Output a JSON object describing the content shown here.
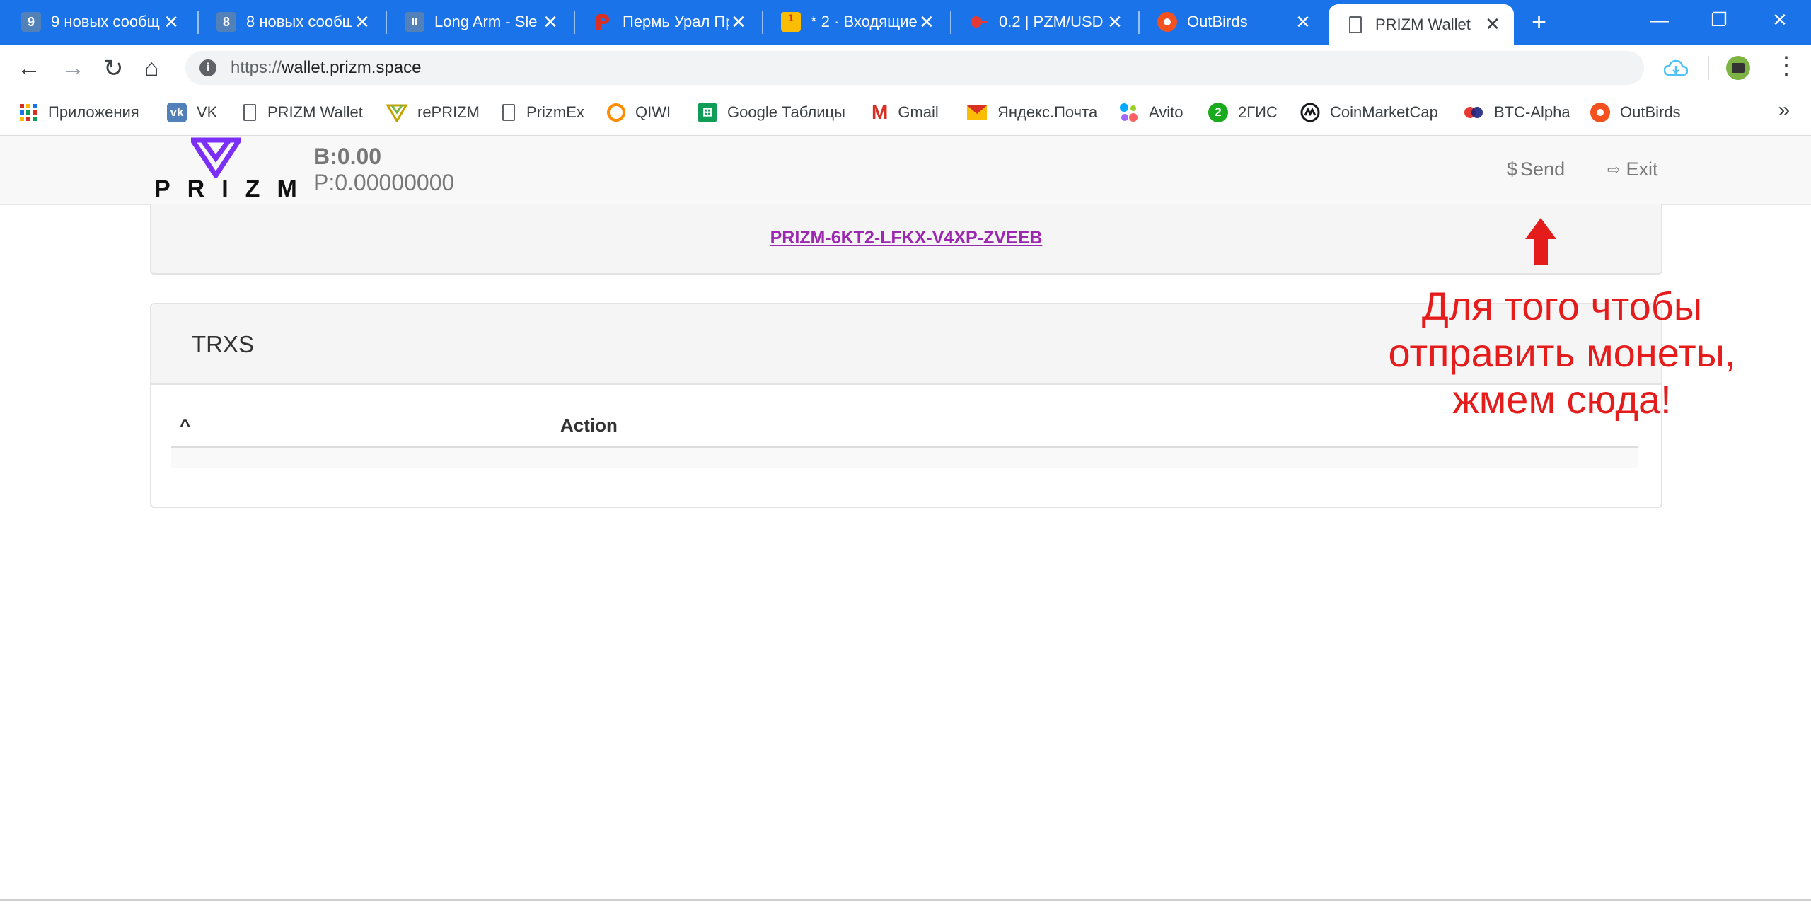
{
  "browser": {
    "tabs": [
      {
        "label": "9 новых сообщ",
        "favicon": "9",
        "favicon_color": "#5181b8",
        "active": false
      },
      {
        "label": "8 новых сообщ",
        "favicon": "8",
        "favicon_color": "#5181b8",
        "active": false
      },
      {
        "label": "Long Arm - Sle",
        "favicon": "II",
        "favicon_color": "#5181b8",
        "active": false
      },
      {
        "label": "Пермь Урал Пр",
        "favicon": "",
        "favicon_color": "#d93025",
        "active": false
      },
      {
        "label": "* 2 · Входящие",
        "favicon": "1",
        "favicon_color": "#fbbc04",
        "active": false
      },
      {
        "label": "0.2 | PZM/USD",
        "favicon": "",
        "favicon_color": "#e53935",
        "active": false
      },
      {
        "label": "OutBirds",
        "favicon": "",
        "favicon_color": "#f4511e",
        "active": false
      },
      {
        "label": "PRIZM Wallet",
        "favicon": "",
        "favicon_color": "#ffffff",
        "active": true
      }
    ],
    "close_glyph": "✕",
    "new_tab_glyph": "+",
    "window_controls": {
      "minimize": "—",
      "restore": "❐",
      "close": "✕"
    },
    "url_scheme": "https://",
    "url_host": "wallet.prizm.space",
    "bookmarks": [
      {
        "label": "Приложения",
        "icon": "apps-icon",
        "color": "#d93025"
      },
      {
        "label": "VK",
        "icon": "vk-icon",
        "color": "#5181b8"
      },
      {
        "label": "PRIZM Wallet",
        "icon": "page-icon",
        "color": "#5f6368"
      },
      {
        "label": "rePRIZM",
        "icon": "reprizm-icon",
        "color": "#c5a300"
      },
      {
        "label": "PrizmEx",
        "icon": "page-icon",
        "color": "#5f6368"
      },
      {
        "label": "QIWI",
        "icon": "qiwi-icon",
        "color": "#ff8c00"
      },
      {
        "label": "Google Таблицы",
        "icon": "sheets-icon",
        "color": "#0f9d58"
      },
      {
        "label": "Gmail",
        "icon": "gmail-icon",
        "color": "#d93025"
      },
      {
        "label": "Яндекс.Почта",
        "icon": "yandex-mail-icon",
        "color": "#f4b400"
      },
      {
        "label": "Avito",
        "icon": "avito-icon",
        "color": "#00aaff"
      },
      {
        "label": "2ГИС",
        "icon": "2gis-icon",
        "color": "#19aa1e"
      },
      {
        "label": "CoinMarketCap",
        "icon": "coinmarketcap-icon",
        "color": "#17181b"
      },
      {
        "label": "BTC-Alpha",
        "icon": "btc-alpha-icon",
        "color": "#e53935"
      },
      {
        "label": "OutBirds",
        "icon": "outbirds-icon",
        "color": "#f4511e"
      }
    ],
    "more_bookmarks": "»"
  },
  "wallet": {
    "logo_text": "PRIZM",
    "balance_b": "B:0.00",
    "balance_p": "P:0.00000000",
    "send_icon": "$",
    "send_label": "Send",
    "exit_icon": "⇨",
    "exit_label": "Exit",
    "account_address": "PRIZM-6KT2-LFKX-V4XP-ZVEEB",
    "transactions_title": "TRXS",
    "table_headers": [
      "^",
      "Action"
    ],
    "accent_color": "#7b2ff7"
  },
  "annotation": {
    "text_lines": [
      "Для того чтобы",
      "отправить монеты,",
      "жмем сюда!"
    ],
    "color": "#e51c1c"
  }
}
